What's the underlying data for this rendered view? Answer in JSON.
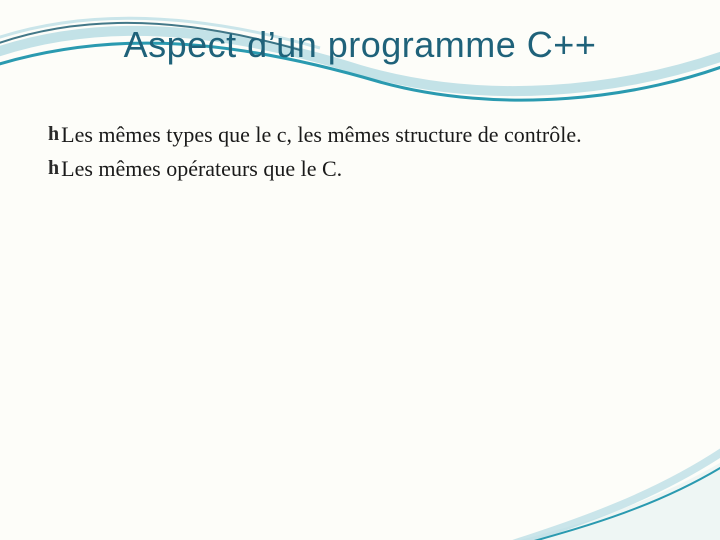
{
  "title": "Aspect d’un programme C++",
  "bullets": [
    "Les mêmes types que le c, les mêmes structure de contrôle.",
    "Les mêmes opérateurs que le C."
  ],
  "bullet_glyph": "h",
  "colors": {
    "title": "#1f627a",
    "wave_mid": "#2a9ab0",
    "wave_light": "#a9d6df",
    "wave_dark": "#14566b",
    "bg": "#fdfdf9"
  }
}
